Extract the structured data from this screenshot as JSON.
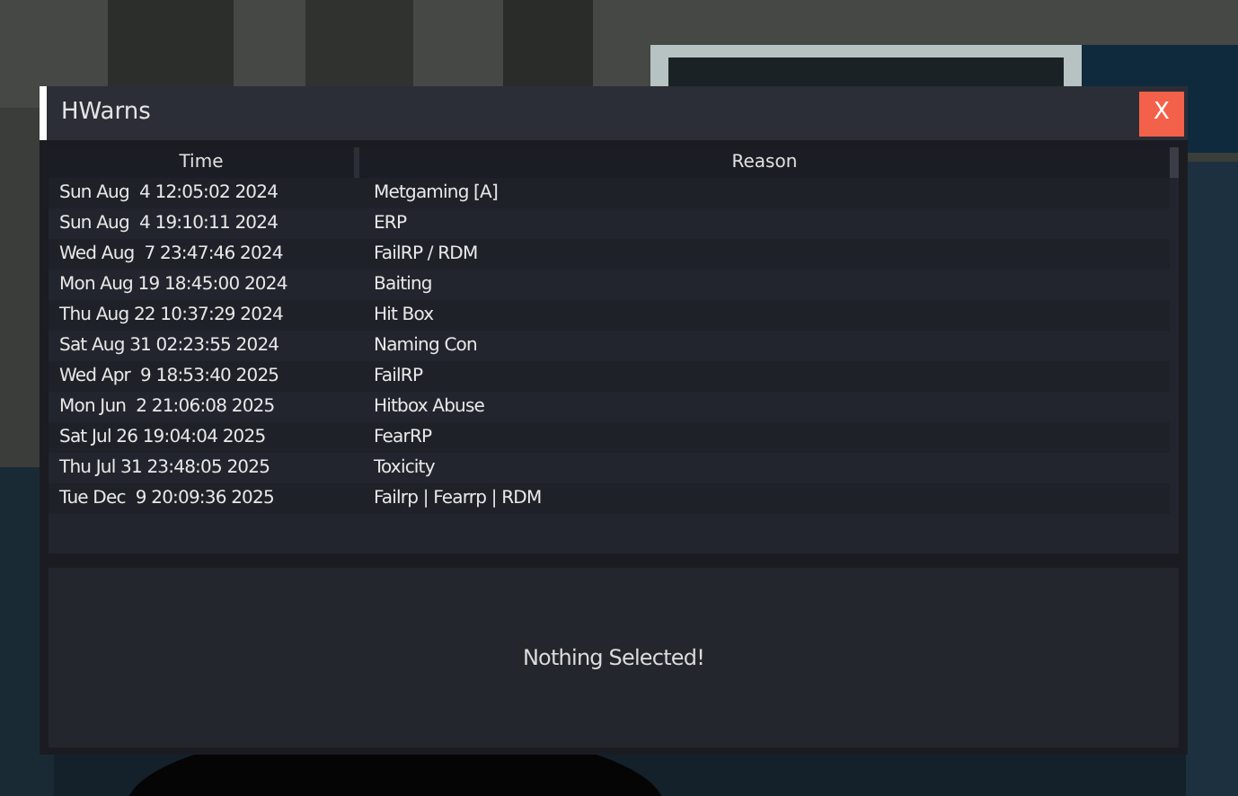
{
  "window": {
    "title": "HWarns",
    "close_label": "X"
  },
  "table": {
    "columns": [
      "Time",
      "Reason"
    ],
    "rows": [
      {
        "time": "Sun Aug  4 12:05:02 2024",
        "reason": "Metgaming [A]"
      },
      {
        "time": "Sun Aug  4 19:10:11 2024",
        "reason": "ERP"
      },
      {
        "time": "Wed Aug  7 23:47:46 2024",
        "reason": "FailRP / RDM"
      },
      {
        "time": "Mon Aug 19 18:45:00 2024",
        "reason": "Baiting"
      },
      {
        "time": "Thu Aug 22 10:37:29 2024",
        "reason": "Hit Box"
      },
      {
        "time": "Sat Aug 31 02:23:55 2024",
        "reason": "Naming Con"
      },
      {
        "time": "Wed Apr  9 18:53:40 2025",
        "reason": "FailRP"
      },
      {
        "time": "Mon Jun  2 21:06:08 2025",
        "reason": "Hitbox Abuse"
      },
      {
        "time": "Sat Jul 26 19:04:04 2025",
        "reason": "FearRP"
      },
      {
        "time": "Thu Jul 31 23:48:05 2025",
        "reason": "Toxicity"
      },
      {
        "time": "Tue Dec  9 20:09:36 2025",
        "reason": "Failrp | Fearrp | RDM"
      }
    ]
  },
  "detail": {
    "message": "Nothing Selected!"
  }
}
